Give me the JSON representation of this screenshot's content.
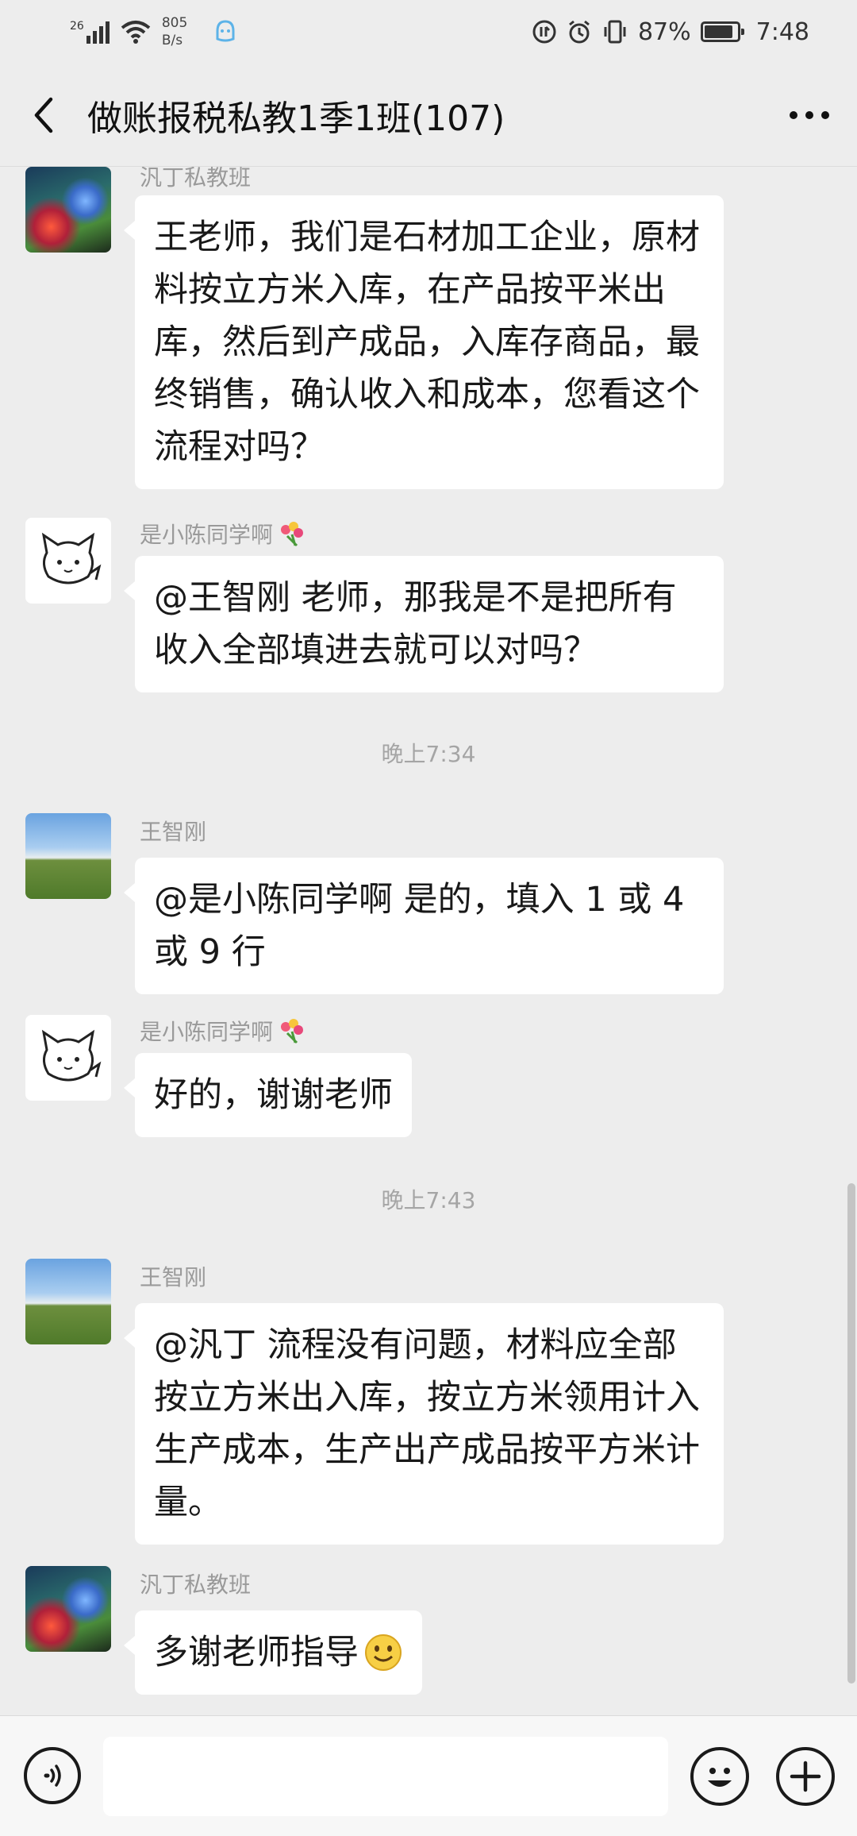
{
  "status_bar": {
    "signal_label": "26",
    "net_speed_value": "805",
    "net_speed_unit": "B/s",
    "battery_percent": "87%",
    "battery_level": 0.87,
    "time": "7:48"
  },
  "header": {
    "title": "做账报税私教1季1班(107)",
    "back_icon": "chevron-left-icon",
    "more_icon": "more-dots-icon"
  },
  "messages": [
    {
      "sender": "汎丁私教班",
      "avatar": "forest-avatar",
      "text": "王老师，我们是石材加工企业，原材料按立方米入库，在产品按平米出库，然后到产成品，入库存商品，最终销售，确认收入和成本，您看这个流程对吗？"
    },
    {
      "sender": "是小陈同学啊",
      "avatar": "cat-avatar",
      "text": "@王智刚  老师，那我是不是把所有收入全部填进去就可以对吗？"
    },
    {
      "timestamp": "晚上7:34"
    },
    {
      "sender": "王智刚",
      "avatar": "field-avatar",
      "text": "@是小陈同学啊   是的，填入 1 或 4 或 9 行"
    },
    {
      "sender": "是小陈同学啊",
      "avatar": "cat-avatar",
      "text": "好的，谢谢老师"
    },
    {
      "timestamp": "晚上7:43"
    },
    {
      "sender": "王智刚",
      "avatar": "field-avatar",
      "text": "@汎丁  流程没有问题，材料应全部按立方米出入库，按立方米领用计入生产成本，生产出产成品按平方米计量。"
    },
    {
      "sender": "汎丁私教班",
      "avatar": "forest-avatar",
      "text": "多谢老师指导"
    }
  ],
  "input_bar": {
    "voice_icon": "voice-icon",
    "emoji_icon": "emoji-icon",
    "plus_icon": "plus-icon"
  }
}
